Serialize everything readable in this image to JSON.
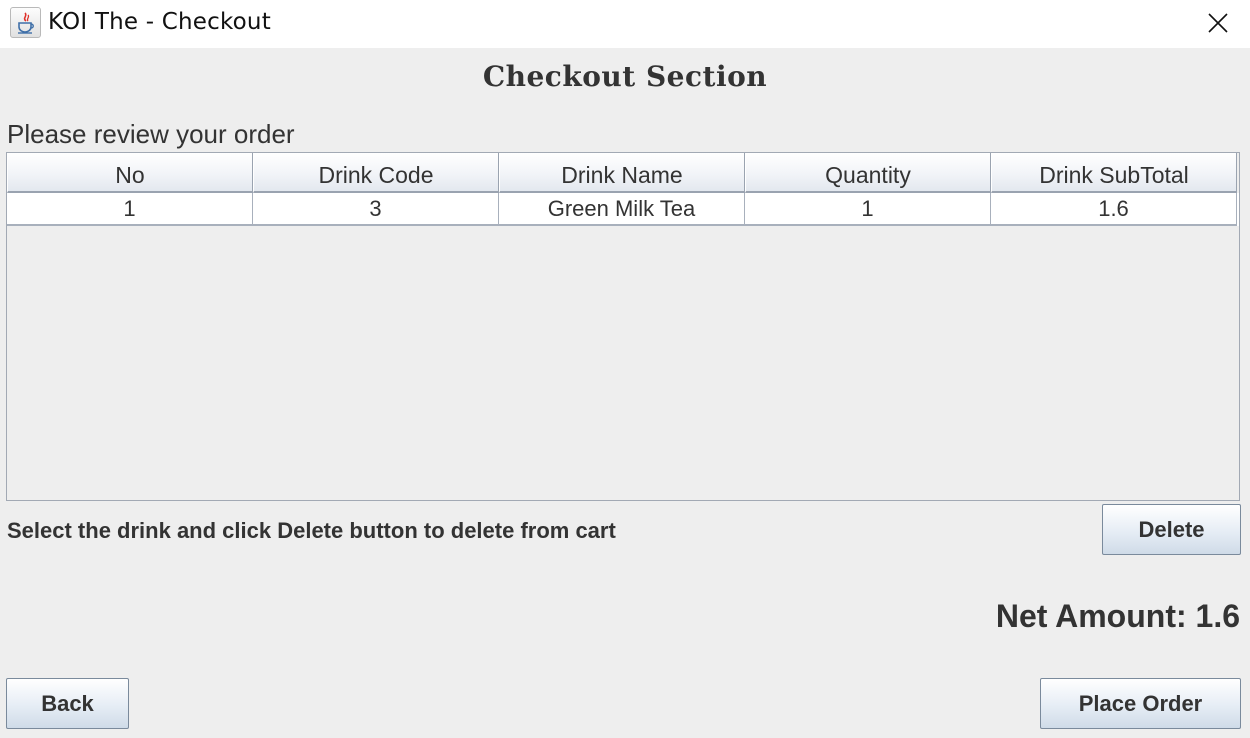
{
  "window": {
    "title": "KOI The - Checkout",
    "icon": "java-coffee-cup-icon",
    "close_icon": "close-icon"
  },
  "header": {
    "title": "Checkout Section"
  },
  "review_label": "Please review your order",
  "table": {
    "columns": [
      "No",
      "Drink Code",
      "Drink Name",
      "Quantity",
      "Drink SubTotal"
    ],
    "rows": [
      [
        "1",
        "3",
        "Green Milk Tea",
        "1",
        "1.6"
      ]
    ]
  },
  "hint": "Select the drink and click Delete button to delete from cart",
  "buttons": {
    "delete": "Delete",
    "back": "Back",
    "place_order": "Place Order"
  },
  "net_amount": {
    "label": "Net Amount:",
    "value": "1.6"
  },
  "colors": {
    "background": "#eeeeee",
    "text": "#333333",
    "table_border": "#a2a9b4"
  }
}
